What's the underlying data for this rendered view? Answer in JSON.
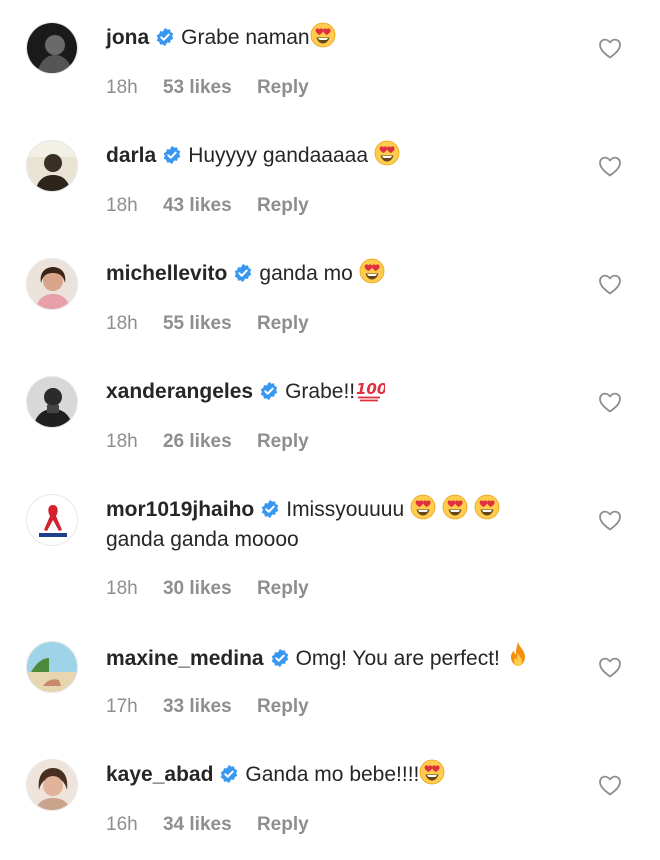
{
  "comments": [
    {
      "username": "jona",
      "text": "Grabe naman",
      "time": "18h",
      "likes": "53 likes",
      "reply": "Reply"
    },
    {
      "username": "darla",
      "text": "Huyyyy gandaaaaa",
      "time": "18h",
      "likes": "43 likes",
      "reply": "Reply"
    },
    {
      "username": "michellevito",
      "text": "ganda mo",
      "time": "18h",
      "likes": "55 likes",
      "reply": "Reply"
    },
    {
      "username": "xanderangeles",
      "text": "Grabe!!",
      "time": "18h",
      "likes": "26 likes",
      "reply": "Reply"
    },
    {
      "username": "mor1019jhaiho",
      "text": "Imissyouuuu",
      "text2": "ganda ganda moooo",
      "time": "18h",
      "likes": "30 likes",
      "reply": "Reply"
    },
    {
      "username": "maxine_medina",
      "text": "Omg! You are perfect!",
      "time": "17h",
      "likes": "33 likes",
      "reply": "Reply"
    },
    {
      "username": "kaye_abad",
      "text": "Ganda mo bebe!!!!",
      "time": "16h",
      "likes": "34 likes",
      "reply": "Reply"
    }
  ],
  "colors": {
    "verified": "#3897f0",
    "meta": "#8e8e8e",
    "text": "#262626"
  },
  "icons": {
    "verified": "verified-badge-icon",
    "like": "heart-outline-icon"
  }
}
